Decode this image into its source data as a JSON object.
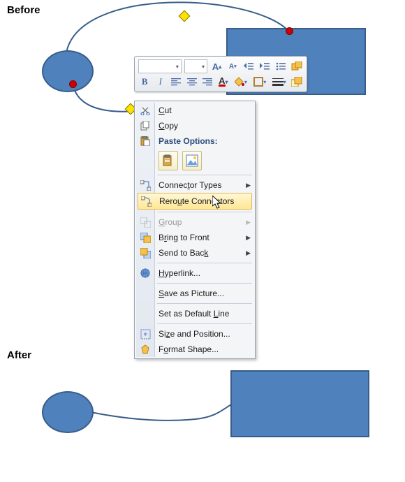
{
  "labels": {
    "before": "Before",
    "after": "After"
  },
  "miniToolbar": {
    "fontFamily": "",
    "fontSize": "",
    "growFont": "A",
    "shrinkFont": "A",
    "bold": "B",
    "italic": "I"
  },
  "contextMenu": {
    "cut": "Cut",
    "copy": "Copy",
    "pasteOptionsLabel": "Paste Options:",
    "connectorTypes": "Connector Types",
    "rerouteConnectors": "Reroute Connectors",
    "group": "Group",
    "bringToFront": "Bring to Front",
    "sendToBack": "Send to Back",
    "hyperlink": "Hyperlink...",
    "saveAsPicture": "Save as Picture...",
    "setAsDefaultLine": "Set as Default Line",
    "sizeAndPosition": "Size and Position...",
    "formatShape": "Format Shape..."
  },
  "colors": {
    "shapeFill": "#4f81bd",
    "shapeStroke": "#385d8a",
    "highlight": "#ffe794"
  }
}
